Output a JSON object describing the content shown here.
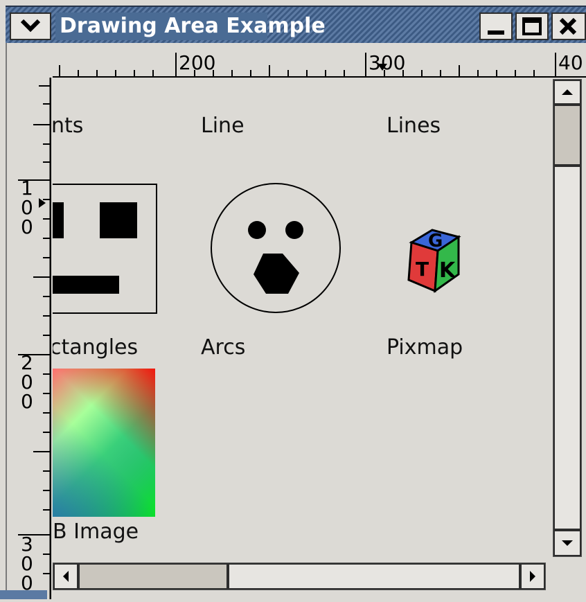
{
  "window": {
    "title": "Drawing Area Example"
  },
  "colors": {
    "titlebar": "#4a6b94",
    "background": "#dcdad5",
    "scroll_track": "#b5b1aa"
  },
  "title_bar": {
    "menu_icon": "chevron-down-icon",
    "minimize_icon": "minimize-icon",
    "maximize_icon": "maximize-icon",
    "close_icon": "close-icon"
  },
  "rulers": {
    "horizontal": {
      "labels": [
        "200",
        "300",
        "40"
      ]
    },
    "vertical": {
      "labels": [
        "100",
        "200",
        "300"
      ]
    }
  },
  "canvas": {
    "labels": {
      "points": "nts",
      "line": "Line",
      "lines": "Lines",
      "rectangles": "ctangles",
      "arcs": "Arcs",
      "pixmap": "Pixmap",
      "rgb_image": "B Image"
    },
    "pixmap_letters": {
      "top": "G",
      "front_left": "T",
      "front_right": "K"
    }
  },
  "scrollbars": {
    "vertical": {
      "up_icon": "arrow-up-icon",
      "down_icon": "arrow-down-icon",
      "position": 0.0
    },
    "horizontal": {
      "left_icon": "arrow-left-icon",
      "right_icon": "arrow-right-icon",
      "position": 0.0
    }
  }
}
